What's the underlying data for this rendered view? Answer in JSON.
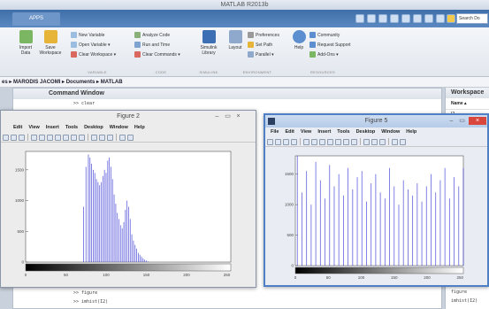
{
  "window": {
    "title": "MATLAB R2013b"
  },
  "tabs": {
    "apps": "APPS"
  },
  "search": {
    "placeholder": "Search Do"
  },
  "ribbon": {
    "variable": {
      "new_variable": "New Variable",
      "open_variable": "Open Variable ▾",
      "clear_workspace": "Clear Workspace ▾",
      "label": "VARIABLE"
    },
    "import_data": "Import\nData",
    "save_workspace": "Save\nWorkspace",
    "code": {
      "analyze_code": "Analyze Code",
      "run_and_time": "Run and Time",
      "clear_commands": "Clear Commands ▾",
      "label": "CODE"
    },
    "simulink": {
      "library": "Simulink\nLibrary",
      "label": "SIMULINK"
    },
    "environment": {
      "layout": "Layout",
      "preferences": "Preferences",
      "set_path": "Set Path",
      "parallel": "Parallel ▾",
      "label": "ENVIRONMENT"
    },
    "resources": {
      "help": "Help",
      "community": "Community",
      "request_support": "Request Support",
      "addons": "Add-Ons ▾",
      "label": "RESOURCES"
    }
  },
  "path": {
    "text": "es ▸ MARODIS JACOMI ▸ Documents ▸ MATLAB"
  },
  "command_window": {
    "title": "Command Window",
    "lines_top": [
      ">> clear"
    ],
    "lines_bottom": [
      ">> figure",
      ">> imhist(I2)"
    ]
  },
  "workspace": {
    "title": "Workspace",
    "name_header": "Name ▴",
    "items": [
      "I2"
    ],
    "history": [
      "figure",
      "imhist(I2)"
    ]
  },
  "figure2": {
    "title": "Figure 2",
    "menu": [
      "Edit",
      "View",
      "Insert",
      "Tools",
      "Desktop",
      "Window",
      "Help"
    ],
    "yticks": [
      "1500",
      "1000",
      "500",
      "0"
    ],
    "xticks": [
      "0",
      "50",
      "100",
      "150",
      "200",
      "250"
    ]
  },
  "figure5": {
    "title": "Figure 5",
    "menu": [
      "File",
      "Edit",
      "View",
      "Insert",
      "Tools",
      "Desktop",
      "Window",
      "Help"
    ],
    "yticks": [
      "1500",
      "1000",
      "500",
      "0"
    ],
    "xticks": [
      "0",
      "50",
      "100",
      "150",
      "200",
      "250"
    ]
  },
  "chart_data": [
    {
      "type": "bar",
      "title": "",
      "xlim": [
        0,
        255
      ],
      "ylim": [
        0,
        1800
      ],
      "x": [
        72,
        75,
        78,
        80,
        82,
        84,
        86,
        88,
        90,
        92,
        94,
        96,
        98,
        100,
        102,
        104,
        106,
        108,
        110,
        112,
        114,
        116,
        118,
        120,
        122,
        124,
        126,
        128,
        130,
        132,
        134,
        136,
        138,
        140,
        142,
        144,
        146,
        148,
        150,
        152
      ],
      "values": [
        900,
        1550,
        1750,
        1700,
        1600,
        1500,
        1450,
        1350,
        1300,
        1250,
        1300,
        1400,
        1500,
        1450,
        1650,
        1700,
        1550,
        1350,
        1100,
        950,
        800,
        700,
        600,
        550,
        650,
        850,
        1000,
        900,
        700,
        450,
        350,
        280,
        220,
        150,
        120,
        90,
        60,
        40,
        25,
        10
      ],
      "colorbar": true,
      "color": "#3b3bd6"
    },
    {
      "type": "bar",
      "title": "",
      "xlim": [
        0,
        255
      ],
      "ylim": [
        0,
        1800
      ],
      "x": [
        3,
        10,
        17,
        24,
        31,
        38,
        45,
        52,
        59,
        66,
        73,
        80,
        87,
        94,
        101,
        108,
        115,
        122,
        129,
        136,
        143,
        150,
        157,
        164,
        171,
        178,
        185,
        192,
        199,
        206,
        213,
        220,
        227,
        234,
        241,
        248,
        255
      ],
      "values": [
        1800,
        1200,
        1550,
        1000,
        1700,
        1400,
        1100,
        1650,
        1300,
        1500,
        1150,
        1600,
        1250,
        1450,
        1550,
        1050,
        1350,
        1500,
        1200,
        1100,
        1600,
        1300,
        1000,
        1400,
        1250,
        1150,
        1350,
        1050,
        1300,
        1500,
        1200,
        1400,
        1600,
        1100,
        1450,
        1300,
        1600
      ],
      "colorbar": true,
      "color": "#3b3bd6"
    }
  ],
  "colors": {
    "ribbon_blue": "#3f6fa9",
    "bar": "#3b3bd6",
    "fig5_border": "#4f7fc4",
    "close": "#d9463c"
  }
}
